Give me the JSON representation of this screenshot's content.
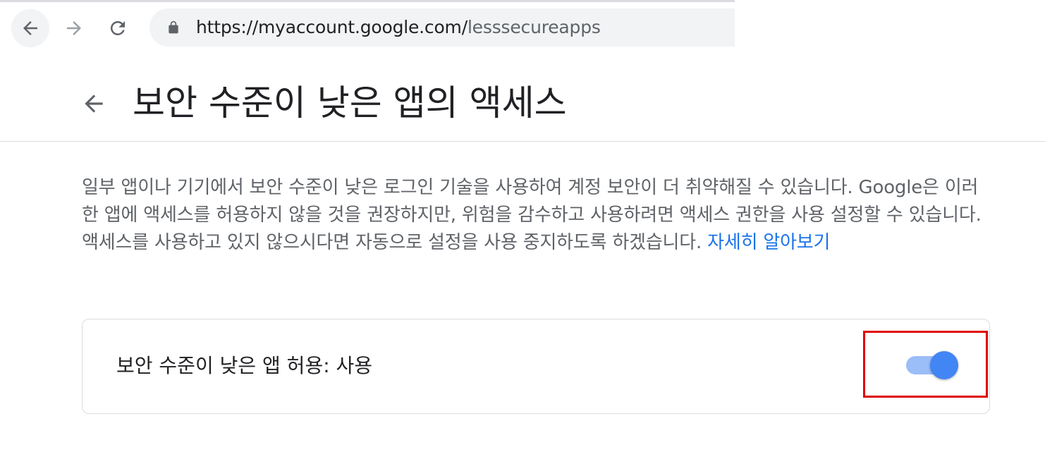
{
  "browser": {
    "url_host": "https://myaccount.google.com/",
    "url_path": "lesssecureapps"
  },
  "page": {
    "title": "보안 수준이 낮은 앱의 액세스"
  },
  "description": {
    "text": "일부 앱이나 기기에서 보안 수준이 낮은 로그인 기술을 사용하여 계정 보안이 더 취약해질 수 있습니다. Google은 이러한 앱에 액세스를 허용하지 않을 것을 권장하지만, 위험을 감수하고 사용하려면 액세스 권한을 사용 설정할 수 있습니다. 액세스를 사용하고 있지 않으시다면 자동으로 설정을 사용 중지하도록 하겠습니다. ",
    "link": "자세히 알아보기"
  },
  "setting": {
    "label": "보안 수준이 낮은 앱 허용: 사용",
    "enabled": true
  },
  "colors": {
    "link": "#1a73e8",
    "toggle_thumb": "#4285f4",
    "toggle_track": "#9bbdf8",
    "highlight": "#e00000"
  },
  "icons": {
    "browser_back": "arrow-left-icon",
    "browser_forward": "arrow-right-icon",
    "reload": "reload-icon",
    "lock": "lock-icon",
    "page_back": "arrow-left-icon"
  }
}
